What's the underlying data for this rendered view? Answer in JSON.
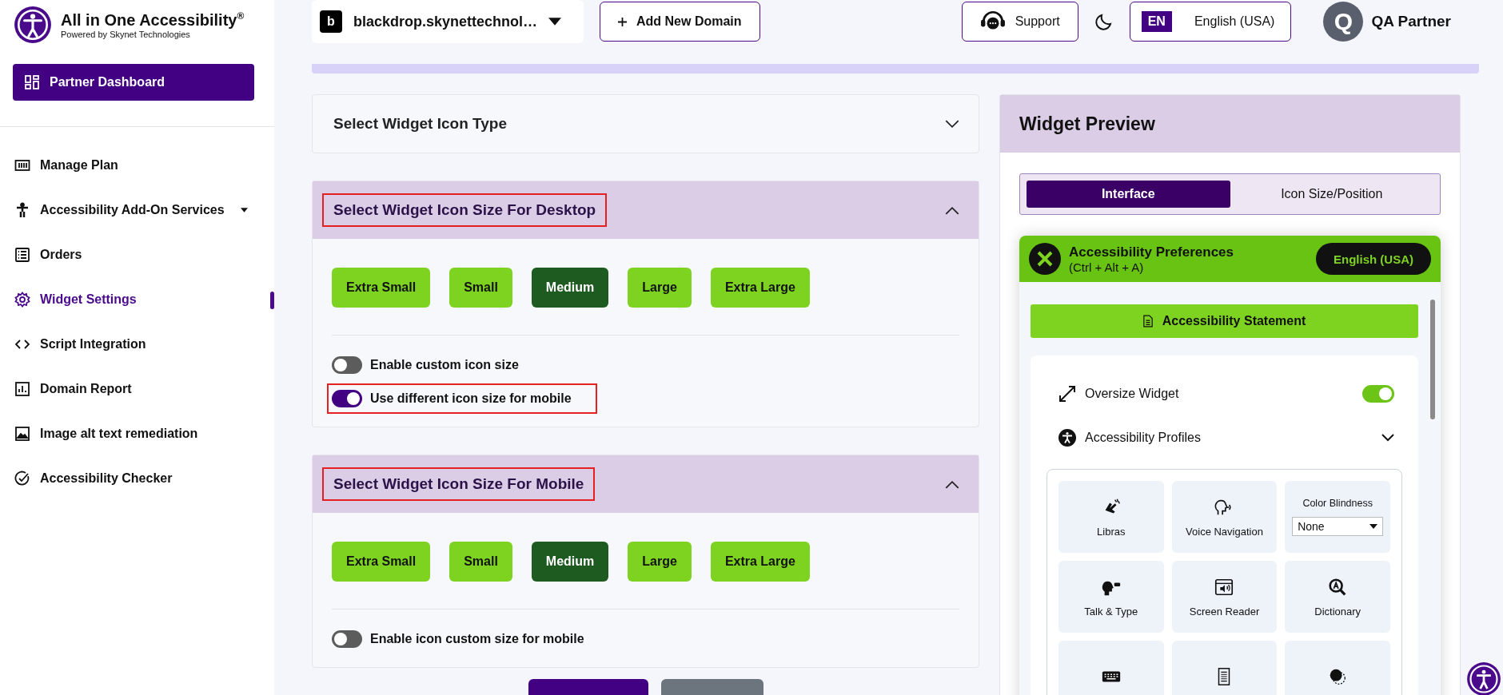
{
  "brand": {
    "title": "All in One Accessibility",
    "mark": "®",
    "subtitle": "Powered by Skynet Technologies"
  },
  "dashboard_button": "Partner Dashboard",
  "sidebar": {
    "items": [
      {
        "label": "Manage Plan",
        "selected": false,
        "has_menu": false
      },
      {
        "label": "Accessibility Add-On Services",
        "selected": false,
        "has_menu": true
      },
      {
        "label": "Orders",
        "selected": false,
        "has_menu": false
      },
      {
        "label": "Widget Settings",
        "selected": true,
        "has_menu": false
      },
      {
        "label": "Script Integration",
        "selected": false,
        "has_menu": false
      },
      {
        "label": "Domain Report",
        "selected": false,
        "has_menu": false
      },
      {
        "label": "Image alt text remediation",
        "selected": false,
        "has_menu": false
      },
      {
        "label": "Accessibility Checker",
        "selected": false,
        "has_menu": false
      }
    ]
  },
  "topbar": {
    "domain_initial": "b",
    "domain": "blackdrop.skynettechnol…",
    "add_domain": "Add New Domain",
    "support": "Support",
    "language_code": "EN",
    "language": "English (USA)",
    "user_initial": "Q",
    "user": "QA Partner"
  },
  "sections": [
    {
      "title": "Select Widget Icon Type",
      "expanded": false,
      "highlighted": false
    },
    {
      "title": "Select Widget Icon Size For Desktop",
      "expanded": true,
      "highlighted": true,
      "sizes": [
        {
          "label": "Extra Small",
          "selected": false
        },
        {
          "label": "Small",
          "selected": false
        },
        {
          "label": "Medium",
          "selected": true
        },
        {
          "label": "Large",
          "selected": false
        },
        {
          "label": "Extra Large",
          "selected": false
        }
      ],
      "toggles": [
        {
          "label": "Enable custom icon size",
          "on": false,
          "highlighted": false
        },
        {
          "label": "Use different icon size for mobile",
          "on": true,
          "highlighted": true
        }
      ]
    },
    {
      "title": "Select Widget Icon Size For Mobile",
      "expanded": true,
      "highlighted": true,
      "sizes": [
        {
          "label": "Extra Small",
          "selected": false
        },
        {
          "label": "Small",
          "selected": false
        },
        {
          "label": "Medium",
          "selected": true
        },
        {
          "label": "Large",
          "selected": false
        },
        {
          "label": "Extra Large",
          "selected": false
        }
      ],
      "toggles": [
        {
          "label": "Enable icon custom size for mobile",
          "on": false,
          "highlighted": false
        }
      ]
    }
  ],
  "footer_buttons": [
    {
      "kind": "primary"
    },
    {
      "kind": "secondary"
    }
  ],
  "preview": {
    "title": "Widget Preview",
    "tabs": [
      {
        "label": "Interface",
        "selected": true
      },
      {
        "label": "Icon Size/Position",
        "selected": false
      }
    ],
    "panel": {
      "title": "Accessibility Preferences",
      "shortcut": "(Ctrl + Alt + A)",
      "language": "English (USA)",
      "statement": "Accessibility Statement",
      "oversize": {
        "label": "Oversize Widget",
        "on": true
      },
      "profiles": {
        "label": "Accessibility Profiles",
        "expanded": false
      },
      "tiles": [
        {
          "kind": "tool",
          "label": "Libras"
        },
        {
          "kind": "tool",
          "label": "Voice Navigation"
        },
        {
          "kind": "select",
          "label": "Color Blindness",
          "value": "None"
        },
        {
          "kind": "tool",
          "label": "Talk & Type"
        },
        {
          "kind": "tool",
          "label": "Screen Reader"
        },
        {
          "kind": "tool",
          "label": "Dictionary"
        },
        {
          "kind": "tool"
        },
        {
          "kind": "tool"
        },
        {
          "kind": "tool"
        }
      ]
    }
  }
}
